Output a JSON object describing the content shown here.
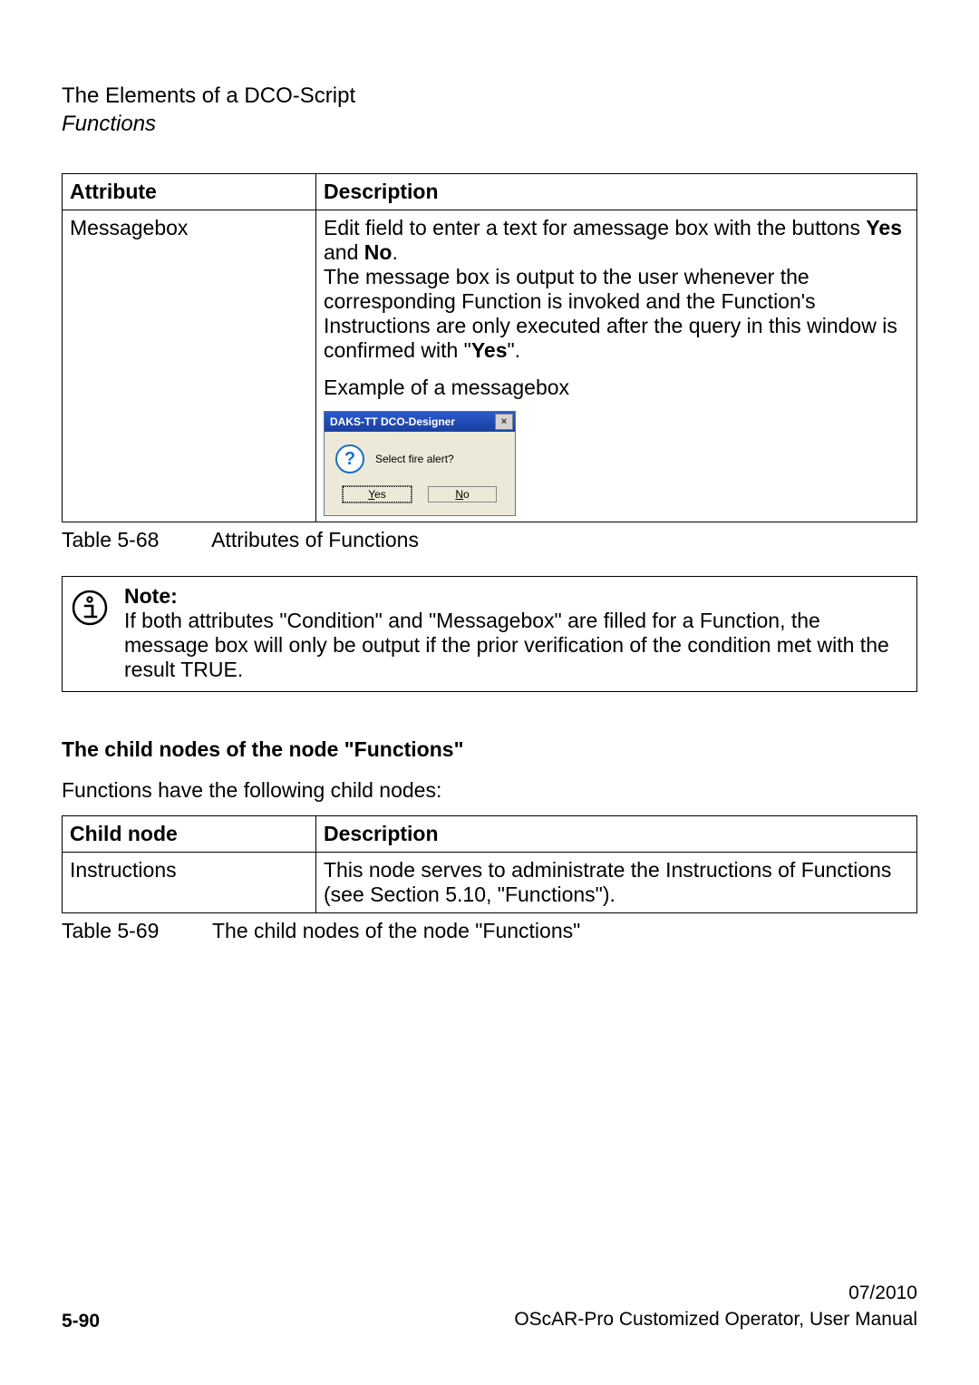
{
  "header": {
    "title": "The Elements of a DCO-Script",
    "subtitle": "Functions"
  },
  "table68": {
    "head": {
      "attr": "Attribute",
      "desc": "Description"
    },
    "attr": "Messagebox",
    "desc_line1a": "Edit field to enter a text for amessage box with the buttons ",
    "desc_line1b": "Yes",
    "desc_line1c": " and ",
    "desc_line1d": "No",
    "desc_line1e": ".",
    "desc_line2": "The message box is output to the user whenever the corresponding Function is invoked and the Function's Instructions are only executed after the query in this window is confirmed with \"",
    "desc_line2b": "Yes",
    "desc_line2c": "\".",
    "example_label": "Example of a messagebox"
  },
  "caption68": {
    "label": "Table 5-68",
    "text": "Attributes of Functions"
  },
  "note": {
    "head": "Note:",
    "text": "If both attributes \"Condition\" and \"Messagebox\" are filled for a Function, the message box will only be output if the prior verification of the condition met with the result TRUE."
  },
  "section_heading": "The child nodes of the node \"Functions\"",
  "lead": "Functions have the following child nodes:",
  "table69": {
    "head": {
      "child": "Child node",
      "desc": "Description"
    },
    "child": "Instructions",
    "desc": "This node serves to administrate the Instructions of Functions (see Section 5.10, \"Functions\")."
  },
  "caption69": {
    "label": "Table 5-69",
    "text": "The child nodes of the node \"Functions\""
  },
  "msgbox": {
    "title": "DAKS-TT DCO-Designer",
    "question": "Select fire alert?",
    "yes_u": "Y",
    "yes_rest": "es",
    "no_u": "N",
    "no_rest": "o"
  },
  "footer": {
    "page": "5-90",
    "date": "07/2010",
    "doc": "OScAR-Pro Customized Operator, User Manual"
  }
}
